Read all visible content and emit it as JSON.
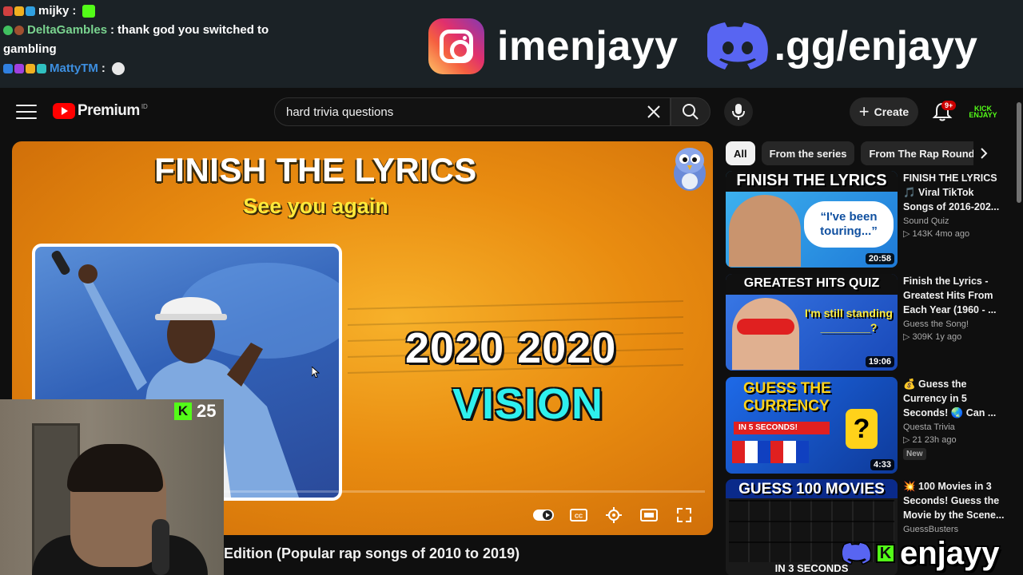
{
  "overlay": {
    "chat": [
      {
        "user": "mijky",
        "sep": ":",
        "message": "",
        "color": "#ffffff"
      },
      {
        "user": "DeltaGambles",
        "sep": ":",
        "message": "thank god you switched to",
        "message_cont": "gambling",
        "color": "#7ad48f"
      },
      {
        "user": "MattyTM",
        "sep": ":",
        "message": "",
        "color": "#3d8fe0"
      }
    ],
    "instagram_handle": "imenjayy",
    "discord_invite": ".gg/enjayy"
  },
  "header": {
    "brand": "Premium",
    "region": "ID",
    "search_value": "hard trivia questions",
    "create_label": "Create",
    "notification_count": "9+",
    "avatar_text": "KICK ENJAYY"
  },
  "player": {
    "title_line": "FINISH THE LYRICS",
    "song_name": "See you again",
    "lyric_line1": "2020 2020",
    "lyric_line2": "VISION",
    "progress": 0.0
  },
  "webcam": {
    "kick_viewers": "25"
  },
  "video_title_visible": "Edition (Popular rap songs of 2010 to 2019)",
  "chips": [
    "All",
    "From the series",
    "From The Rap Round"
  ],
  "recommendations": [
    {
      "thumb_title": "FINISH THE LYRICS",
      "thumb_quote": "“I've been touring...”",
      "duration": "20:58",
      "title": "FINISH THE LYRICS 🎵 Viral TikTok Songs of 2016-202...",
      "channel": "Sound Quiz",
      "stats": "▷ 143K  4mo ago",
      "new": ""
    },
    {
      "thumb_title": "GREATEST HITS QUIZ",
      "thumb_quote": "I'm still standing ________?",
      "duration": "19:06",
      "title": "Finish the Lyrics - Greatest Hits From Each Year (1960 - ...",
      "channel": "Guess the Song!",
      "stats": "▷ 309K  1y ago",
      "new": ""
    },
    {
      "thumb_title": "GUESS THE CURRENCY",
      "thumb_quote": "IN 5 SECONDS!",
      "duration": "4:33",
      "title": "💰 Guess the Currency in 5 Seconds! 🌏 Can ...",
      "channel": "Questa Trivia",
      "stats": "▷ 21  23h ago",
      "new": "New"
    },
    {
      "thumb_title": "GUESS 100 MOVIES",
      "thumb_quote": "IN 3 SECONDS",
      "duration": "",
      "title": "💥 100 Movies in 3 Seconds! Guess the Movie by the Scene...",
      "channel": "GuessBusters",
      "stats": "",
      "new": ""
    }
  ],
  "bottom_brand": "enjayy",
  "colors": {
    "accent_red": "#ff0000",
    "kick_green": "#53fc18",
    "player_orange": "#f0a020"
  }
}
